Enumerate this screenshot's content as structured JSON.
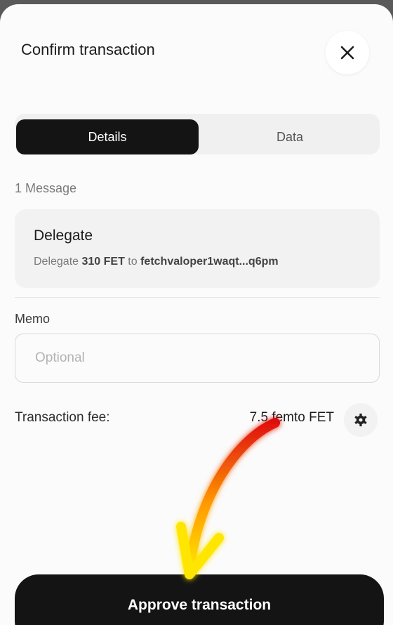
{
  "header": {
    "title": "Confirm transaction",
    "close_icon": "close-icon"
  },
  "tabs": [
    {
      "label": "Details",
      "active": true
    },
    {
      "label": "Data",
      "active": false
    }
  ],
  "messages": {
    "count_label": "1 Message",
    "items": [
      {
        "title": "Delegate",
        "prefix": "Delegate ",
        "amount": "310 FET",
        "connector": " to ",
        "validator": "fetchvaloper1waqt...q6pm"
      }
    ]
  },
  "memo": {
    "label": "Memo",
    "placeholder": "Optional",
    "value": ""
  },
  "fee": {
    "label": "Transaction fee:",
    "value": "7.5 femto FET",
    "settings_icon": "gear-icon"
  },
  "footer": {
    "approve_label": "Approve transaction"
  },
  "annotation": {
    "arrow_icon": "annotation-arrow-icon",
    "colors": [
      "#e01010",
      "#ff9a00",
      "#ffe600"
    ]
  }
}
